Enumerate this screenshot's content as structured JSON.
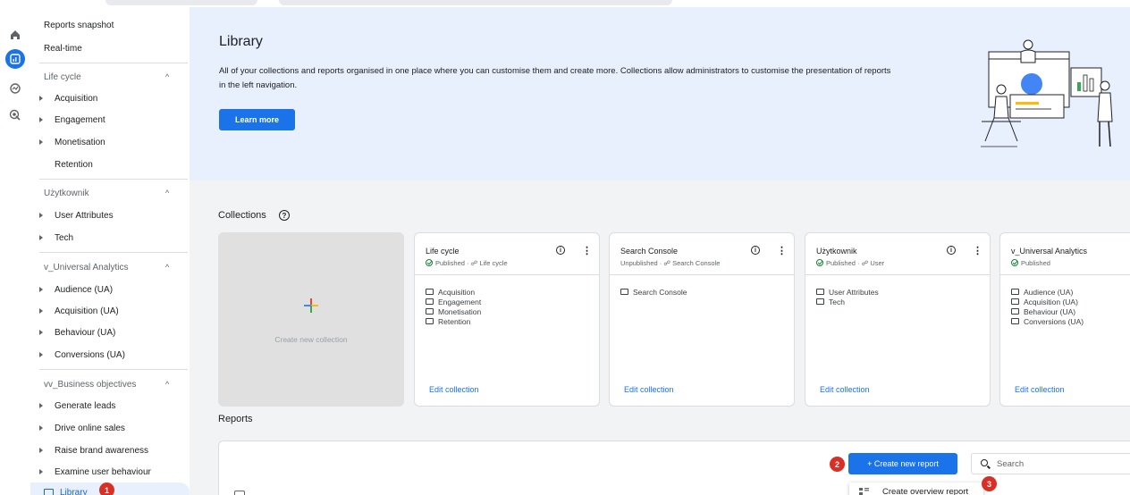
{
  "sidebar": {
    "top_items": [
      "Reports snapshot",
      "Real-time"
    ],
    "sections": [
      {
        "title": "Life cycle",
        "items": [
          "Acquisition",
          "Engagement",
          "Monetisation",
          "Retention"
        ]
      },
      {
        "title": "Użytkownik",
        "items": [
          "User Attributes",
          "Tech"
        ]
      },
      {
        "title": "v_Universal Analytics",
        "items": [
          "Audience (UA)",
          "Acquisition (UA)",
          "Behaviour (UA)",
          "Conversions (UA)"
        ]
      },
      {
        "title": "vv_Business objectives",
        "items": [
          "Generate leads",
          "Drive online sales",
          "Raise brand awareness",
          "Examine user behaviour"
        ]
      }
    ],
    "active_item": "Library"
  },
  "hero": {
    "title": "Library",
    "description": "All of your collections and reports organised in one place where you can customise them and create more. Collections allow administrators to customise the presentation of reports in the left navigation.",
    "learn_more": "Learn more"
  },
  "collections": {
    "title": "Collections",
    "create_label": "Create new collection",
    "cards": [
      {
        "title": "Life cycle",
        "status": "Published",
        "source": "Life cycle",
        "items": [
          "Acquisition",
          "Engagement",
          "Monetisation",
          "Retention"
        ],
        "edit": "Edit collection"
      },
      {
        "title": "Search Console",
        "status": "Unpublished",
        "source": "Search Console",
        "items": [
          "Search Console"
        ],
        "edit": "Edit collection"
      },
      {
        "title": "Użytkownik",
        "status": "Published",
        "source": "User",
        "items": [
          "User Attributes",
          "Tech"
        ],
        "edit": "Edit collection"
      },
      {
        "title": "v_Universal Analytics",
        "status": "Published",
        "source": "",
        "items": [
          "Audience (UA)",
          "Acquisition (UA)",
          "Behaviour (UA)",
          "Conversions (UA)"
        ],
        "edit": "Edit collection"
      }
    ]
  },
  "reports": {
    "title": "Reports",
    "create_button": "+ Create new report",
    "search_placeholder": "Search",
    "dropdown_item": "Create overview report"
  },
  "badges": [
    "1",
    "2",
    "3"
  ],
  "colors": {
    "accent": "#1a73e8",
    "hero_bg": "#e8f0fe",
    "badge": "#d93025",
    "published": "#188038"
  }
}
